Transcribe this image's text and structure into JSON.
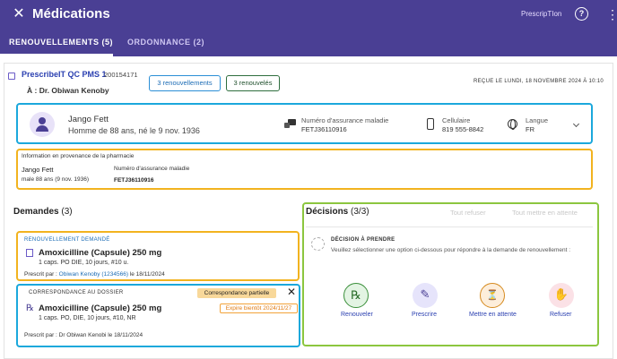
{
  "appbar": {
    "title": "Médications",
    "brand": "PrescripTIon",
    "help_glyph": "?",
    "more_glyph": "⋮",
    "close_glyph": "✕"
  },
  "tabs": [
    {
      "label": "RENOUVELLEMENTS (5)",
      "active": true
    },
    {
      "label": "ORDONNANCE (2)",
      "active": false
    }
  ],
  "header": {
    "pharmacy_name": "PrescribeIT QC PMS 1",
    "pharmacy_id": "200154171",
    "to_line": "À :  Dr. Obiwan Kenoby",
    "pill_renewals": "3 renouvellements",
    "pill_renewed": "3 renouvelés",
    "received": "REÇUE LE LUNDI, 18 NOVEMBRE 2024 À 10:10"
  },
  "patient": {
    "name": "Jango Fett",
    "subtitle": "Homme de 88 ans, né le 9 nov. 1936",
    "insurance_label": "Numéro d'assurance maladie",
    "insurance_value": "FETJ36110916",
    "cell_label": "Cellulaire",
    "cell_value": "819 555-8842",
    "language_label": "Langue",
    "language_value": "FR"
  },
  "pharmacy_info": {
    "title": "Information en provenance de la pharmacie",
    "name": "Jango Fett",
    "subtitle": "male 88 ans (9 nov. 1936)",
    "insurance_label": "Numéro d'assurance maladie",
    "insurance_value": "FETJ36110916"
  },
  "demandes": {
    "title": "Demandes",
    "count": "(3)",
    "request": {
      "tag": "RENOUVELLEMENT DEMANDÉ",
      "medication": "Amoxicilline (Capsule) 250 mg",
      "dose": "1 caps. PO DIE, 10 jours, #10 u.",
      "prescriber_prefix": "Prescrit par : ",
      "prescriber_link": "Obiwan Kenoby (1234566)",
      "prescriber_suffix": " le 18/11/2024"
    },
    "match": {
      "tag": "CORRESPONDANCE AU DOSSIER",
      "badge": "Correspondance partielle",
      "close_glyph": "✕",
      "rx_glyph": "℞",
      "medication": "Amoxicilline (Capsule) 250 mg",
      "expiry": "Expire bientôt 2024/11/27",
      "dose": "1 caps. PO, DIE, 10 jours, #10, NR",
      "prescriber": "Prescrit par : Dr Obiwan Kenobi le 18/11/2024"
    }
  },
  "decisions": {
    "title": "Décisions",
    "count": "(3/3)",
    "refuse_all": "Tout refuser",
    "wait_all": "Tout mettre en attente",
    "tag": "DÉCISION À PRENDRE",
    "help": "Veuillez sélectionner une option ci-dessous pour répondre à la demande de renouvellement :",
    "actions": [
      {
        "label": "Renouveler",
        "icon": "renew-rx-icon",
        "glyph": "℞"
      },
      {
        "label": "Prescrire",
        "icon": "prescribe-icon",
        "glyph": "✎"
      },
      {
        "label": "Mettre en attente",
        "icon": "hold-icon",
        "glyph": "⏳"
      },
      {
        "label": "Refuser",
        "icon": "refuse-hand-icon",
        "glyph": "✋"
      }
    ]
  }
}
